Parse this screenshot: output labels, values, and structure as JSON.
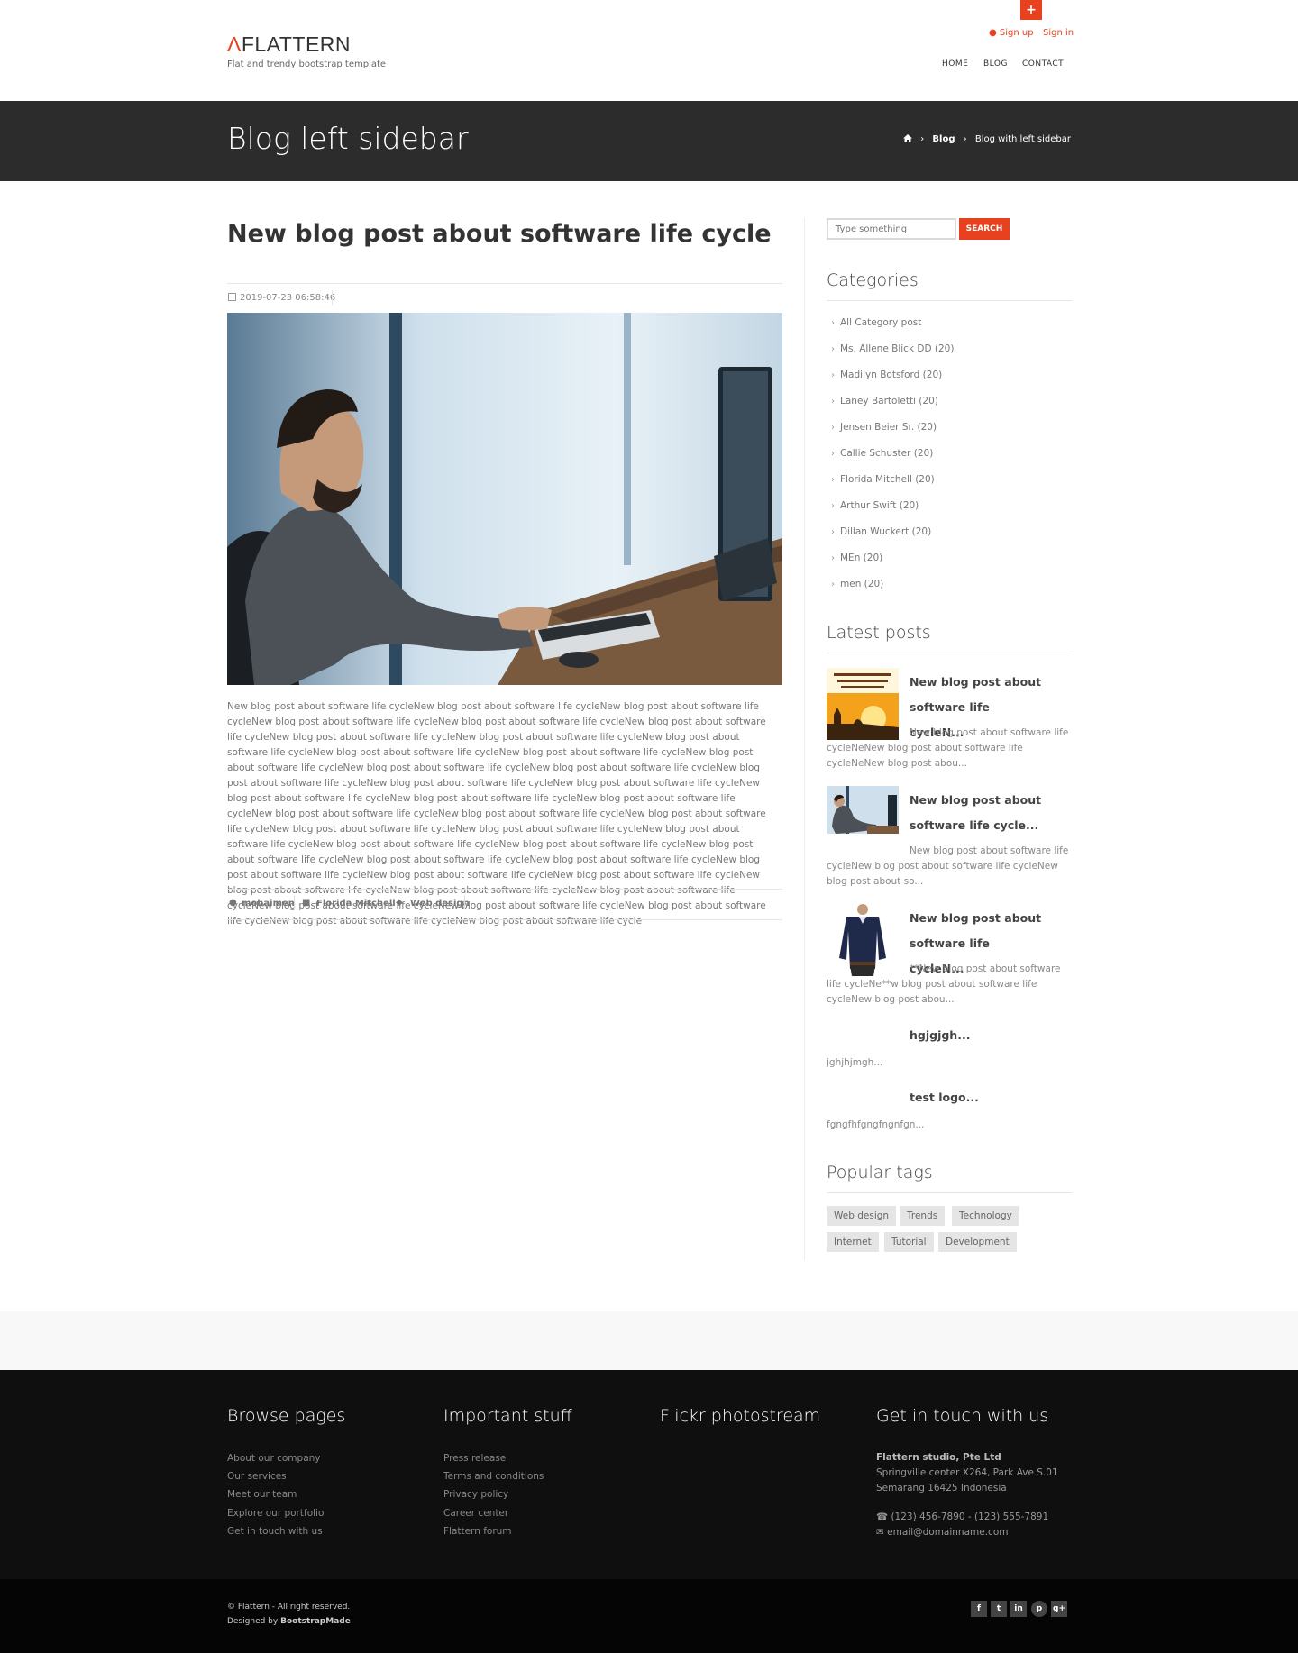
{
  "header": {
    "logo_mark": "Λ",
    "logo_text": "FLATTERN",
    "tagline": "Flat and trendy bootstrap template",
    "top_button": "+",
    "signup": "Sign up",
    "signin": "Sign in",
    "nav": [
      "HOME",
      "BLOG",
      "CONTACT"
    ]
  },
  "titlebar": {
    "title": "Blog left sidebar",
    "breadcrumb": [
      "Blog",
      "Blog with left sidebar"
    ],
    "separator": "›"
  },
  "post": {
    "title": "New blog post about software life cycle",
    "date": "2019-07-23 06:58:46",
    "body": "New blog post about software life cycleNew blog post about software life cycleNew blog post about software life cycleNew blog post about software life cycleNew blog post about software life cycleNew blog post about software life cycleNew blog post about software life cycleNew blog post about software life cycleNew blog post about software life cycleNew blog post about software life cycleNew blog post about software life cycleNew blog post about software life cycleNew blog post about software life cycleNew blog post about software life cycleNew blog post about software life cycleNew blog post about software life cycleNew blog post about software life cycleNew blog post about software life cycleNew blog post about software life cycleNew blog post about software life cycleNew blog post about software life cycleNew blog post about software life cycleNew blog post about software life cycleNew blog post about software life cycleNew blog post about software life cycleNew blog post about software life cycleNew blog post about software life cycleNew blog post about software life cycleNew blog post about software life cycleNew blog post about software life cycleNew blog post about software life cycleNew blog post about software life cycleNew blog post about software life cycleNew blog post about software life cycleNew blog post about software life cycleNew blog post about software life cycleNew blog post about software life cycleNew blog post about software life cycleNew blog post about software life cycleNew blog post about software life cycleNew blog post about software life cycleNew blog post about software life cycle",
    "author": "mohaimen",
    "category": "Florida Mitchell",
    "tag": "Web design"
  },
  "sidebar": {
    "search_placeholder": "Type something",
    "search_button": "SEARCH",
    "categories_title": "Categories",
    "categories": [
      "All Category post",
      "Ms. Allene Blick DD (20)",
      "Madilyn Botsford (20)",
      "Laney Bartoletti (20)",
      "Jensen Beier Sr. (20)",
      "Callie Schuster (20)",
      "Florida Mitchell (20)",
      "Arthur Swift (20)",
      "Dillan Wuckert (20)",
      "MEn (20)",
      "men (20)"
    ],
    "latest_title": "Latest posts",
    "latest": [
      {
        "title_1": "New blog post about",
        "title_2": "software life cycleN...",
        "excerpt": "New blog post about software life cycleNeNew blog post about software life cycleNeNew blog post abou..."
      },
      {
        "title_1": "New blog post about",
        "title_2": "software life cycle...",
        "excerpt": "New blog post about software life cycleNew blog post about software life cycleNew blog post about so..."
      },
      {
        "title_1": "New blog post about",
        "title_2": "software life cycleN...",
        "excerpt": "**New blog post about software life cycleNe**w blog post about software life cycleNew blog post abou..."
      },
      {
        "title_1": "hgjgjgh...",
        "excerpt": "jghjhjmgh..."
      },
      {
        "title_1": "test logo...",
        "excerpt": "fgngfhfgngfngnfgn..."
      }
    ],
    "tags_title": "Popular tags",
    "tags": [
      "Web design",
      "Trends",
      "Technology",
      "Internet",
      "Tutorial",
      "Development"
    ]
  },
  "footer": {
    "browse_title": "Browse pages",
    "browse": [
      "About our company",
      "Our services",
      "Meet our team",
      "Explore our portfolio",
      "Get in touch with us"
    ],
    "important_title": "Important stuff",
    "important": [
      "Press release",
      "Terms and conditions",
      "Privacy policy",
      "Career center",
      "Flattern forum"
    ],
    "flickr_title": "Flickr photostream",
    "contact_title": "Get in touch with us",
    "company": "Flattern studio, Pte Ltd",
    "address_1": "Springville center X264, Park Ave S.01",
    "address_2": "Semarang 16425 Indonesia",
    "phone": "(123) 456-7890 - (123) 555-7891",
    "email": "email@domainname.com",
    "copyright": "© Flattern - All right reserved.",
    "designed_prefix": "Designed by ",
    "designed_by": "BootstrapMade",
    "social": [
      "f",
      "t",
      "in",
      "p",
      "g+"
    ]
  },
  "colors": {
    "accent": "#e8411f",
    "titlebar_bg": "#2c2c2c",
    "footer_bg": "#0f0f0f"
  }
}
